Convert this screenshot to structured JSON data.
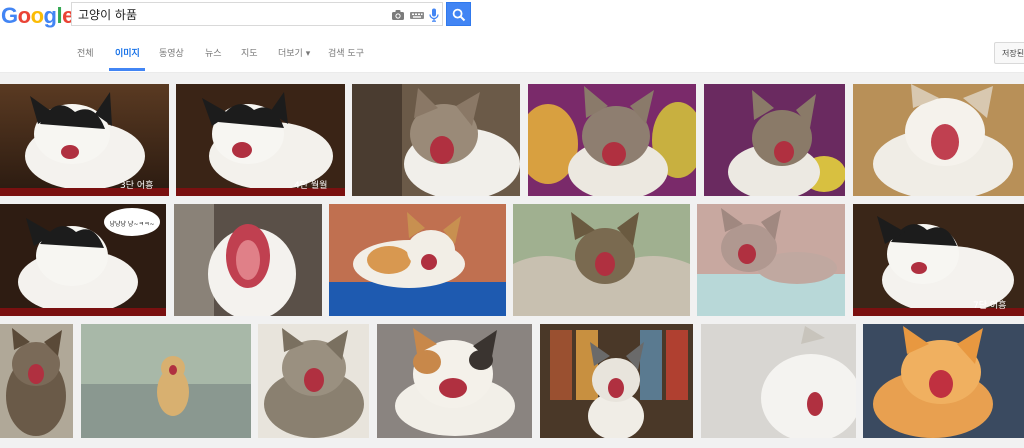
{
  "logo": {
    "letters": [
      "G",
      "o",
      "o",
      "g",
      "l",
      "e"
    ],
    "colors": [
      "#4285f4",
      "#ea4335",
      "#fbbc05",
      "#4285f4",
      "#34a853",
      "#ea4335"
    ]
  },
  "search": {
    "query": "고양이 하품"
  },
  "icons": {
    "camera": "camera-icon",
    "keyboard": "keyboard-icon",
    "mic": "microphone-icon",
    "search": "search-icon"
  },
  "nav": {
    "tabs": [
      {
        "label": "전체"
      },
      {
        "label": "이미지"
      },
      {
        "label": "동영상"
      },
      {
        "label": "뉴스"
      },
      {
        "label": "지도"
      },
      {
        "label": "더보기 ▾"
      },
      {
        "label": "검색 도구"
      }
    ],
    "saved_label": "저장된 이"
  },
  "images": {
    "captions": [
      "3단 어흥",
      "4단 월월",
      "",
      "",
      "",
      "",
      "",
      "",
      "",
      "",
      "",
      "",
      "",
      "7단 어흥"
    ],
    "bubble": "냥냥냥 냥~ㅋㅋ~"
  },
  "colors": {
    "accent": "#4285f4",
    "active_tab": "#1a73e8",
    "background": "#f1f1f1"
  }
}
